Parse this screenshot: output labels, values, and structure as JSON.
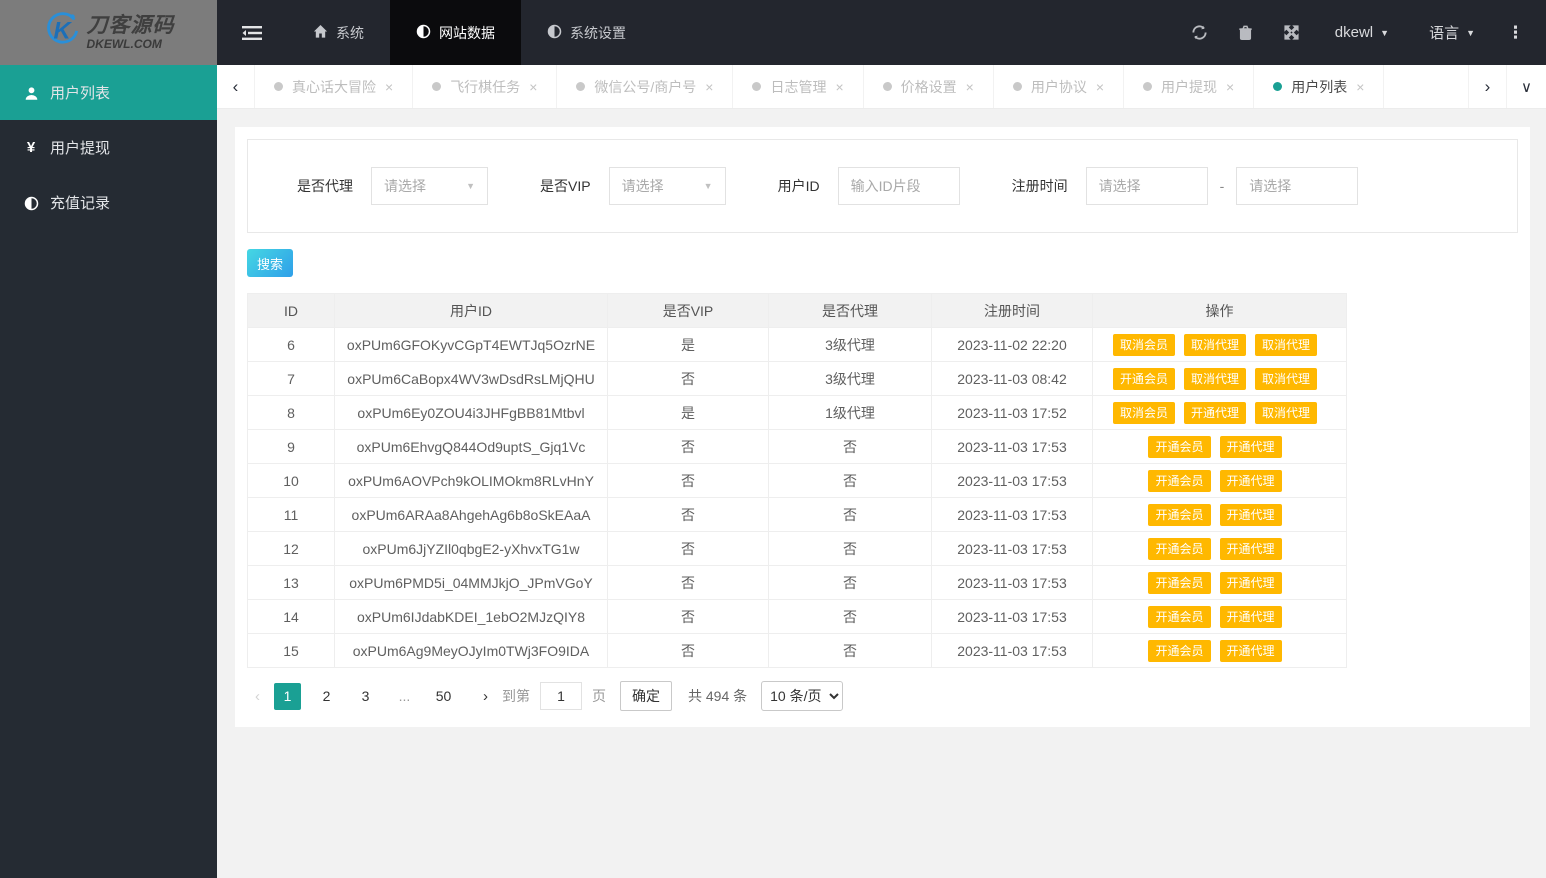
{
  "colors": {
    "accent_teal": "#1aa094",
    "action_orange": "#ffb800",
    "danger_red": "#ff2b2b",
    "topbar_dark": "#23262e",
    "sidebar_dark": "#252b33"
  },
  "topbar": {
    "logo": {
      "title": "刀客源码",
      "subtitle": "DKEWL.COM"
    },
    "nav": [
      {
        "label": "系统",
        "icon": "home-icon",
        "active": false
      },
      {
        "label": "网站数据",
        "icon": "half-circle-icon",
        "active": true
      },
      {
        "label": "系统设置",
        "icon": "half-circle-icon",
        "active": false
      }
    ],
    "action_icons": [
      "refresh-icon",
      "trash-icon",
      "fullscreen-icon"
    ],
    "user_menu": {
      "label": "dkewl",
      "caret": "▼"
    },
    "language_menu": {
      "label": "语言",
      "caret": "▼"
    },
    "more_glyph": "⋮"
  },
  "sidebar": {
    "items": [
      {
        "label": "用户列表",
        "icon": "user-icon",
        "active": true
      },
      {
        "label": "用户提现",
        "icon": "yen-icon",
        "active": false
      },
      {
        "label": "充值记录",
        "icon": "half-circle-icon",
        "active": false
      }
    ]
  },
  "tabbar": {
    "scroll_left_glyph": "‹",
    "scroll_right_glyph": "›",
    "menu_glyph": "∨",
    "close_glyph": "×",
    "tabs": [
      {
        "label": "真心话大冒险",
        "active": false
      },
      {
        "label": "飞行棋任务",
        "active": false
      },
      {
        "label": "微信公号/商户号",
        "active": false
      },
      {
        "label": "日志管理",
        "active": false
      },
      {
        "label": "价格设置",
        "active": false
      },
      {
        "label": "用户协议",
        "active": false
      },
      {
        "label": "用户提现",
        "active": false
      },
      {
        "label": "用户列表",
        "active": true
      }
    ]
  },
  "filters": {
    "agent_label": "是否代理",
    "agent_value": "请选择",
    "vip_label": "是否VIP",
    "vip_value": "请选择",
    "userid_label": "用户ID",
    "userid_placeholder": "输入ID片段",
    "regtime_label": "注册时间",
    "regtime_from_placeholder": "请选择",
    "regtime_to_placeholder": "请选择",
    "range_separator": "-",
    "search_label": "搜索",
    "select_caret": "▼"
  },
  "table": {
    "headers": [
      "ID",
      "用户ID",
      "是否VIP",
      "是否代理",
      "注册时间",
      "操作"
    ],
    "rows": [
      {
        "id": "6",
        "user_id": "oxPUm6GFOKyvCGpT4EWTJq5OzrNE",
        "vip": "是",
        "vip_danger": false,
        "agent": "3级代理",
        "agent_danger": false,
        "time": "2023-11-02 22:20",
        "actions": [
          "取消会员",
          "取消代理",
          "取消代理"
        ]
      },
      {
        "id": "7",
        "user_id": "oxPUm6CaBopx4WV3wDsdRsLMjQHU",
        "vip": "否",
        "vip_danger": true,
        "agent": "3级代理",
        "agent_danger": false,
        "time": "2023-11-03 08:42",
        "actions": [
          "开通会员",
          "取消代理",
          "取消代理"
        ]
      },
      {
        "id": "8",
        "user_id": "oxPUm6Ey0ZOU4i3JHFgBB81Mtbvl",
        "vip": "是",
        "vip_danger": false,
        "agent": "1级代理",
        "agent_danger": false,
        "time": "2023-11-03 17:52",
        "actions": [
          "取消会员",
          "开通代理",
          "取消代理"
        ]
      },
      {
        "id": "9",
        "user_id": "oxPUm6EhvgQ844Od9uptS_Gjq1Vc",
        "vip": "否",
        "vip_danger": true,
        "agent": "否",
        "agent_danger": true,
        "time": "2023-11-03 17:53",
        "actions": [
          "开通会员",
          "开通代理"
        ]
      },
      {
        "id": "10",
        "user_id": "oxPUm6AOVPch9kOLIMOkm8RLvHnY",
        "vip": "否",
        "vip_danger": true,
        "agent": "否",
        "agent_danger": true,
        "time": "2023-11-03 17:53",
        "actions": [
          "开通会员",
          "开通代理"
        ]
      },
      {
        "id": "11",
        "user_id": "oxPUm6ARAa8AhgehAg6b8oSkEAaA",
        "vip": "否",
        "vip_danger": true,
        "agent": "否",
        "agent_danger": true,
        "time": "2023-11-03 17:53",
        "actions": [
          "开通会员",
          "开通代理"
        ]
      },
      {
        "id": "12",
        "user_id": "oxPUm6JjYZIl0qbgE2-yXhvxTG1w",
        "vip": "否",
        "vip_danger": true,
        "agent": "否",
        "agent_danger": true,
        "time": "2023-11-03 17:53",
        "actions": [
          "开通会员",
          "开通代理"
        ]
      },
      {
        "id": "13",
        "user_id": "oxPUm6PMD5i_04MMJkjO_JPmVGoY",
        "vip": "否",
        "vip_danger": true,
        "agent": "否",
        "agent_danger": true,
        "time": "2023-11-03 17:53",
        "actions": [
          "开通会员",
          "开通代理"
        ]
      },
      {
        "id": "14",
        "user_id": "oxPUm6IJdabKDEI_1ebO2MJzQIY8",
        "vip": "否",
        "vip_danger": true,
        "agent": "否",
        "agent_danger": true,
        "time": "2023-11-03 17:53",
        "actions": [
          "开通会员",
          "开通代理"
        ]
      },
      {
        "id": "15",
        "user_id": "oxPUm6Ag9MeyOJyIm0TWj3FO9IDA",
        "vip": "否",
        "vip_danger": true,
        "agent": "否",
        "agent_danger": true,
        "time": "2023-11-03 17:53",
        "actions": [
          "开通会员",
          "开通代理"
        ]
      }
    ]
  },
  "pagination": {
    "prev_glyph": "‹",
    "next_glyph": "›",
    "pages": [
      {
        "label": "1",
        "active": true,
        "ellipsis": false
      },
      {
        "label": "2",
        "active": false,
        "ellipsis": false
      },
      {
        "label": "3",
        "active": false,
        "ellipsis": false
      },
      {
        "label": "...",
        "active": false,
        "ellipsis": true
      },
      {
        "label": "50",
        "active": false,
        "ellipsis": false
      }
    ],
    "jump_prefix": "到第",
    "jump_value": "1",
    "jump_suffix": "页",
    "confirm_label": "确定",
    "total_label": "共 494 条",
    "page_size_label": "10 条/页"
  }
}
